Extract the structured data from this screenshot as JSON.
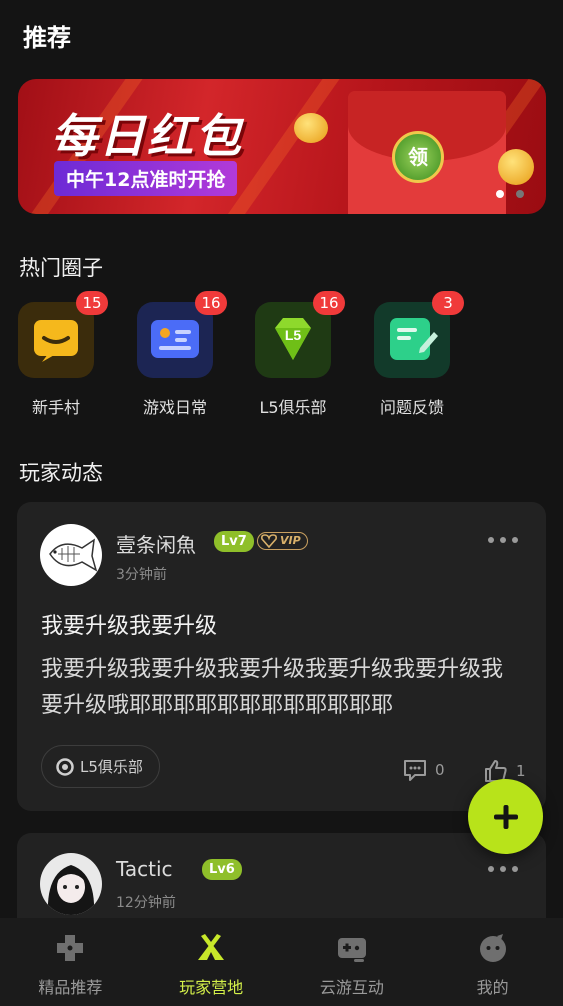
{
  "page_title": "推荐",
  "banner": {
    "title": "每日红包",
    "subtitle": "中午12点准时开抢",
    "button_label": "领",
    "page_count": 2,
    "active_page": 1
  },
  "hot_circles": {
    "title": "热门圈子",
    "items": [
      {
        "label": "新手村",
        "badge": "15",
        "icon": "chat-bubble-icon",
        "color": "#f5b81c"
      },
      {
        "label": "游戏日常",
        "badge": "16",
        "icon": "profile-card-icon",
        "color": "#4b6cf7"
      },
      {
        "label": "L5俱乐部",
        "badge": "16",
        "icon": "diamond-icon",
        "color": "#7fd12a"
      },
      {
        "label": "问题反馈",
        "badge": "3",
        "icon": "edit-note-icon",
        "color": "#2dd08a"
      }
    ]
  },
  "feed": {
    "title": "玩家动态",
    "posts": [
      {
        "username": "壹条闲魚",
        "level": "Lv7",
        "vip": "VIP",
        "time": "3分钟前",
        "title": "我要升级我要升级",
        "body": "我要升级我要升级我要升级我要升级我要升级我要升级哦耶耶耶耶耶耶耶耶耶耶耶耶",
        "tag": "L5俱乐部",
        "comments": "0",
        "likes": "1"
      },
      {
        "username": "Tactic",
        "level": "Lv6",
        "time": "12分钟前"
      }
    ]
  },
  "bottom_nav": {
    "items": [
      {
        "label": "精品推荐",
        "icon": "gamepad-icon"
      },
      {
        "label": "玩家营地",
        "icon": "camp-icon",
        "active": true
      },
      {
        "label": "云游互动",
        "icon": "cloud-game-icon"
      },
      {
        "label": "我的",
        "icon": "profile-icon"
      }
    ]
  },
  "colors": {
    "background": "#141414",
    "card": "#222222",
    "accent": "#b8e31a",
    "badge": "#f03a3a",
    "level_badge": "#8fbf2a"
  }
}
